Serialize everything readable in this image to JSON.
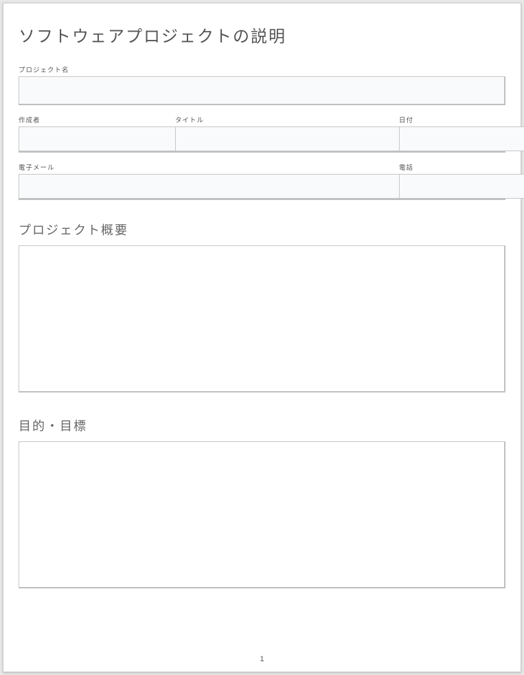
{
  "document": {
    "title": "ソフトウェアプロジェクトの説明",
    "page_number": "1"
  },
  "fields": {
    "project_name": {
      "label": "プロジェクト名",
      "value": ""
    },
    "author": {
      "label": "作成者",
      "value": ""
    },
    "job_title": {
      "label": "タイトル",
      "value": ""
    },
    "date": {
      "label": "日付",
      "value": ""
    },
    "email": {
      "label": "電子メール",
      "value": ""
    },
    "phone": {
      "label": "電話",
      "value": ""
    }
  },
  "sections": {
    "overview": {
      "heading": "プロジェクト概要",
      "value": ""
    },
    "goals": {
      "heading": "目的・目標",
      "value": ""
    }
  }
}
